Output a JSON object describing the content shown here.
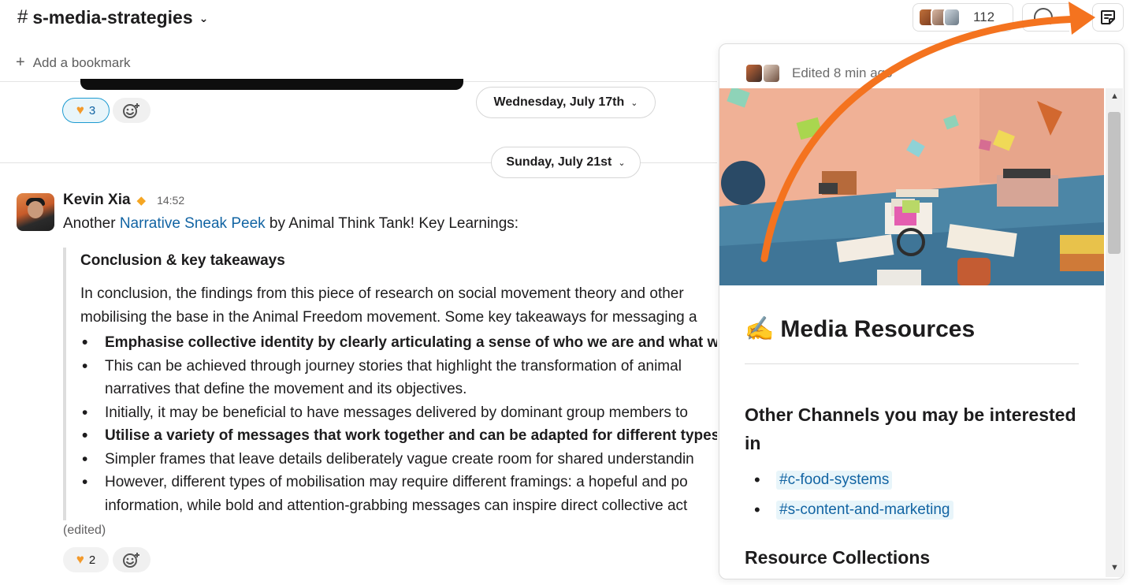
{
  "header": {
    "hash": "#",
    "channel": "s-media-strategies",
    "member_count": "112"
  },
  "bookmark": {
    "label": "Add a bookmark"
  },
  "reactions_top": {
    "heart_count": "3"
  },
  "dates": {
    "first": "Wednesday, July 17th",
    "second": "Sunday, July 21st"
  },
  "message": {
    "sender": "Kevin Xia",
    "time": "14:52",
    "text_before": "Another ",
    "link": "Narrative Sneak Peek",
    "text_after": " by Animal Think Tank! Key Learnings:",
    "quote_title": "Conclusion & key takeaways",
    "quote_lines": [
      "In conclusion, the findings from this piece of research on social movement theory and other",
      "mobilising the base in the Animal Freedom movement. Some key takeaways for messaging a"
    ],
    "bullets": [
      "Emphasise collective identity by clearly articulating a sense of who we are and what we",
      "This can be achieved through journey stories that highlight the transformation of animal",
      "narratives that define the movement and its objectives.",
      "Initially, it may be beneficial to have messages delivered by dominant group members to",
      "Utilise a variety of messages that work together and can be adapted for different types",
      "Simpler frames that leave details deliberately vague create room for shared understandin",
      "However, different types of mobilisation may require different framings: a hopeful and po",
      "information, while bold and attention-grabbing messages can inspire direct collective act"
    ],
    "edited": "(edited)",
    "heart_count": "2"
  },
  "panel": {
    "edited": "Edited 8 min ago",
    "title_emoji": "✍️",
    "title": "Media Resources",
    "section_heading": "Other Channels you may be interested in",
    "channels": [
      "#c-food-systems",
      "#s-content-and-marketing"
    ],
    "section_heading_2": "Resource Collections"
  },
  "colors": {
    "link": "#1264a3",
    "accent_arrow": "#f4731f",
    "heart": "#f39a2b",
    "selected_reaction_border": "#1d9bd1"
  }
}
